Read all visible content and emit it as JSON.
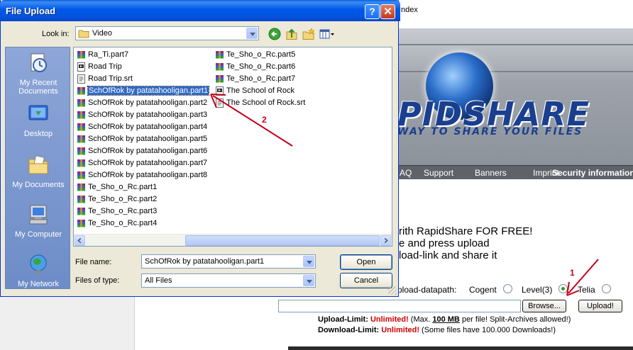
{
  "background": {
    "top_link": "Index",
    "brand": {
      "logo_text": "PIDSHARE",
      "tagline": "WAY TO SHARE YOUR FILES"
    },
    "nav": [
      {
        "label": "AQ"
      },
      {
        "label": "Support"
      },
      {
        "label": "Banners"
      },
      {
        "label": "Imprint"
      },
      {
        "label": "Security information"
      }
    ],
    "promo_lines": [
      "rith RapidShare FOR FREE!",
      "e and press upload",
      "load-link and share it"
    ],
    "datapath_label": "pload-datapath:",
    "servers": [
      {
        "label": "Cogent",
        "selected": false
      },
      {
        "label": "Level(3)",
        "selected": true
      },
      {
        "label": "Telia",
        "selected": false
      }
    ],
    "browse_label": "Browse...",
    "upload_label": "Upload!",
    "upload_limit": {
      "label": "Upload-Limit:",
      "value": "Unlimited!",
      "pre": " (Max. ",
      "max": "100 MB",
      "post": " per file! Split-Archives allowed!)"
    },
    "download_limit": {
      "label": "Download-Limit:",
      "value": "Unlimited!",
      "post": " (Some files have 100.000 Downloads!)"
    }
  },
  "dialog": {
    "title": "File Upload",
    "help_glyph": "?",
    "close_glyph": "✕",
    "look_in_label": "Look in:",
    "look_in_value": "Video",
    "toolbar_icons": [
      "back-icon",
      "up-folder-icon",
      "new-folder-icon",
      "views-menu-icon"
    ],
    "places": [
      {
        "label": "My Recent Documents",
        "icon": "recent-documents-icon"
      },
      {
        "label": "Desktop",
        "icon": "desktop-icon"
      },
      {
        "label": "My Documents",
        "icon": "my-documents-icon"
      },
      {
        "label": "My Computer",
        "icon": "my-computer-icon"
      },
      {
        "label": "My Network",
        "icon": "my-network-icon"
      }
    ],
    "files_col1": [
      {
        "name": "Ra_Ti.part7",
        "kind": "rar"
      },
      {
        "name": "Road Trip",
        "kind": "video"
      },
      {
        "name": "Road Trip.srt",
        "kind": "srt"
      },
      {
        "name": "SchOfRok by patatahooligan.part1",
        "kind": "rar",
        "selected": true
      },
      {
        "name": "SchOfRok by patatahooligan.part2",
        "kind": "rar"
      },
      {
        "name": "SchOfRok by patatahooligan.part3",
        "kind": "rar"
      },
      {
        "name": "SchOfRok by patatahooligan.part4",
        "kind": "rar"
      },
      {
        "name": "SchOfRok by patatahooligan.part5",
        "kind": "rar"
      },
      {
        "name": "SchOfRok by patatahooligan.part6",
        "kind": "rar"
      },
      {
        "name": "SchOfRok by patatahooligan.part7",
        "kind": "rar"
      },
      {
        "name": "SchOfRok by patatahooligan.part8",
        "kind": "rar"
      },
      {
        "name": "Te_Sho_o_Rc.part1",
        "kind": "rar"
      },
      {
        "name": "Te_Sho_o_Rc.part2",
        "kind": "rar"
      },
      {
        "name": "Te_Sho_o_Rc.part3",
        "kind": "rar"
      },
      {
        "name": "Te_Sho_o_Rc.part4",
        "kind": "rar"
      }
    ],
    "files_col2": [
      {
        "name": "Te_Sho_o_Rc.part5",
        "kind": "rar"
      },
      {
        "name": "Te_Sho_o_Rc.part6",
        "kind": "rar"
      },
      {
        "name": "Te_Sho_o_Rc.part7",
        "kind": "rar"
      },
      {
        "name": "The School of Rock",
        "kind": "video"
      },
      {
        "name": "The School of Rock.srt",
        "kind": "srt"
      }
    ],
    "file_name_label": "File name:",
    "file_name_value": "SchOfRok by patatahooligan.part1",
    "file_type_label": "Files of type:",
    "file_type_value": "All Files",
    "open_label": "Open",
    "cancel_label": "Cancel"
  },
  "annotations": {
    "step1": "1",
    "step2": "2",
    "color": "#c4001a"
  }
}
